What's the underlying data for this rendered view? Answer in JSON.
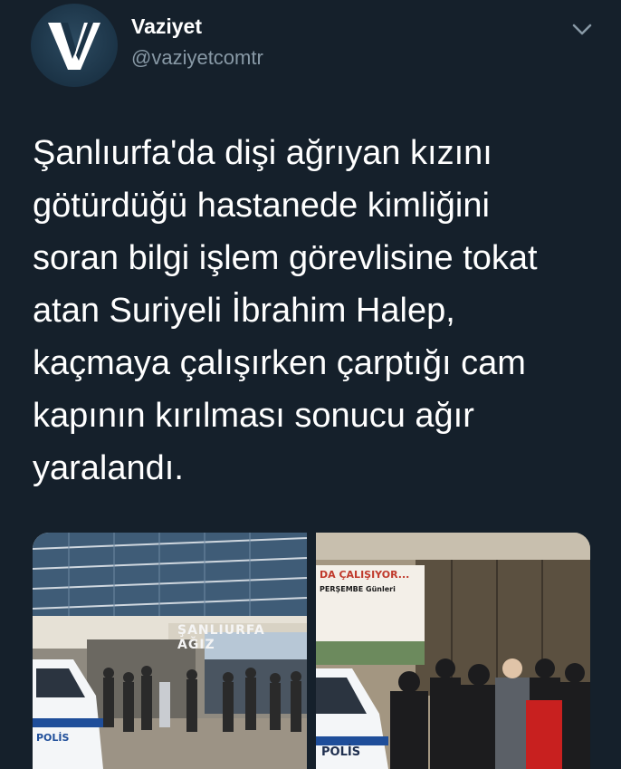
{
  "account": {
    "name": "Vaziyet",
    "handle": "@vaziyetcomtr",
    "avatar_icon": "vaziyet-v-logo-icon"
  },
  "menu": {
    "icon": "chevron-down-icon"
  },
  "tweet": {
    "text": "Şanlıurfa'da dişi ağrıyan kızını\ngötürdüğü hastanede kimliğini\nsoran bilgi işlem görevlisine tokat\natan Suriyeli İbrahim Halep,\nkaçmaya çalışırken çarptığı cam\nkapının kırılması sonucu ağır\nyaralandı."
  },
  "media": {
    "left_photo": {
      "building_sign": "ŞANLIURFA AĞIZ",
      "vehicle_text": "POLİS"
    },
    "right_photo": {
      "banner_line1": "DA ÇALIŞIYOR...",
      "banner_line2": "PERŞEMBE Günleri",
      "vehicle_text": "POLİS"
    }
  },
  "colors": {
    "background": "#15202b",
    "primary_text": "#ffffff",
    "secondary_text": "#8899a6"
  }
}
